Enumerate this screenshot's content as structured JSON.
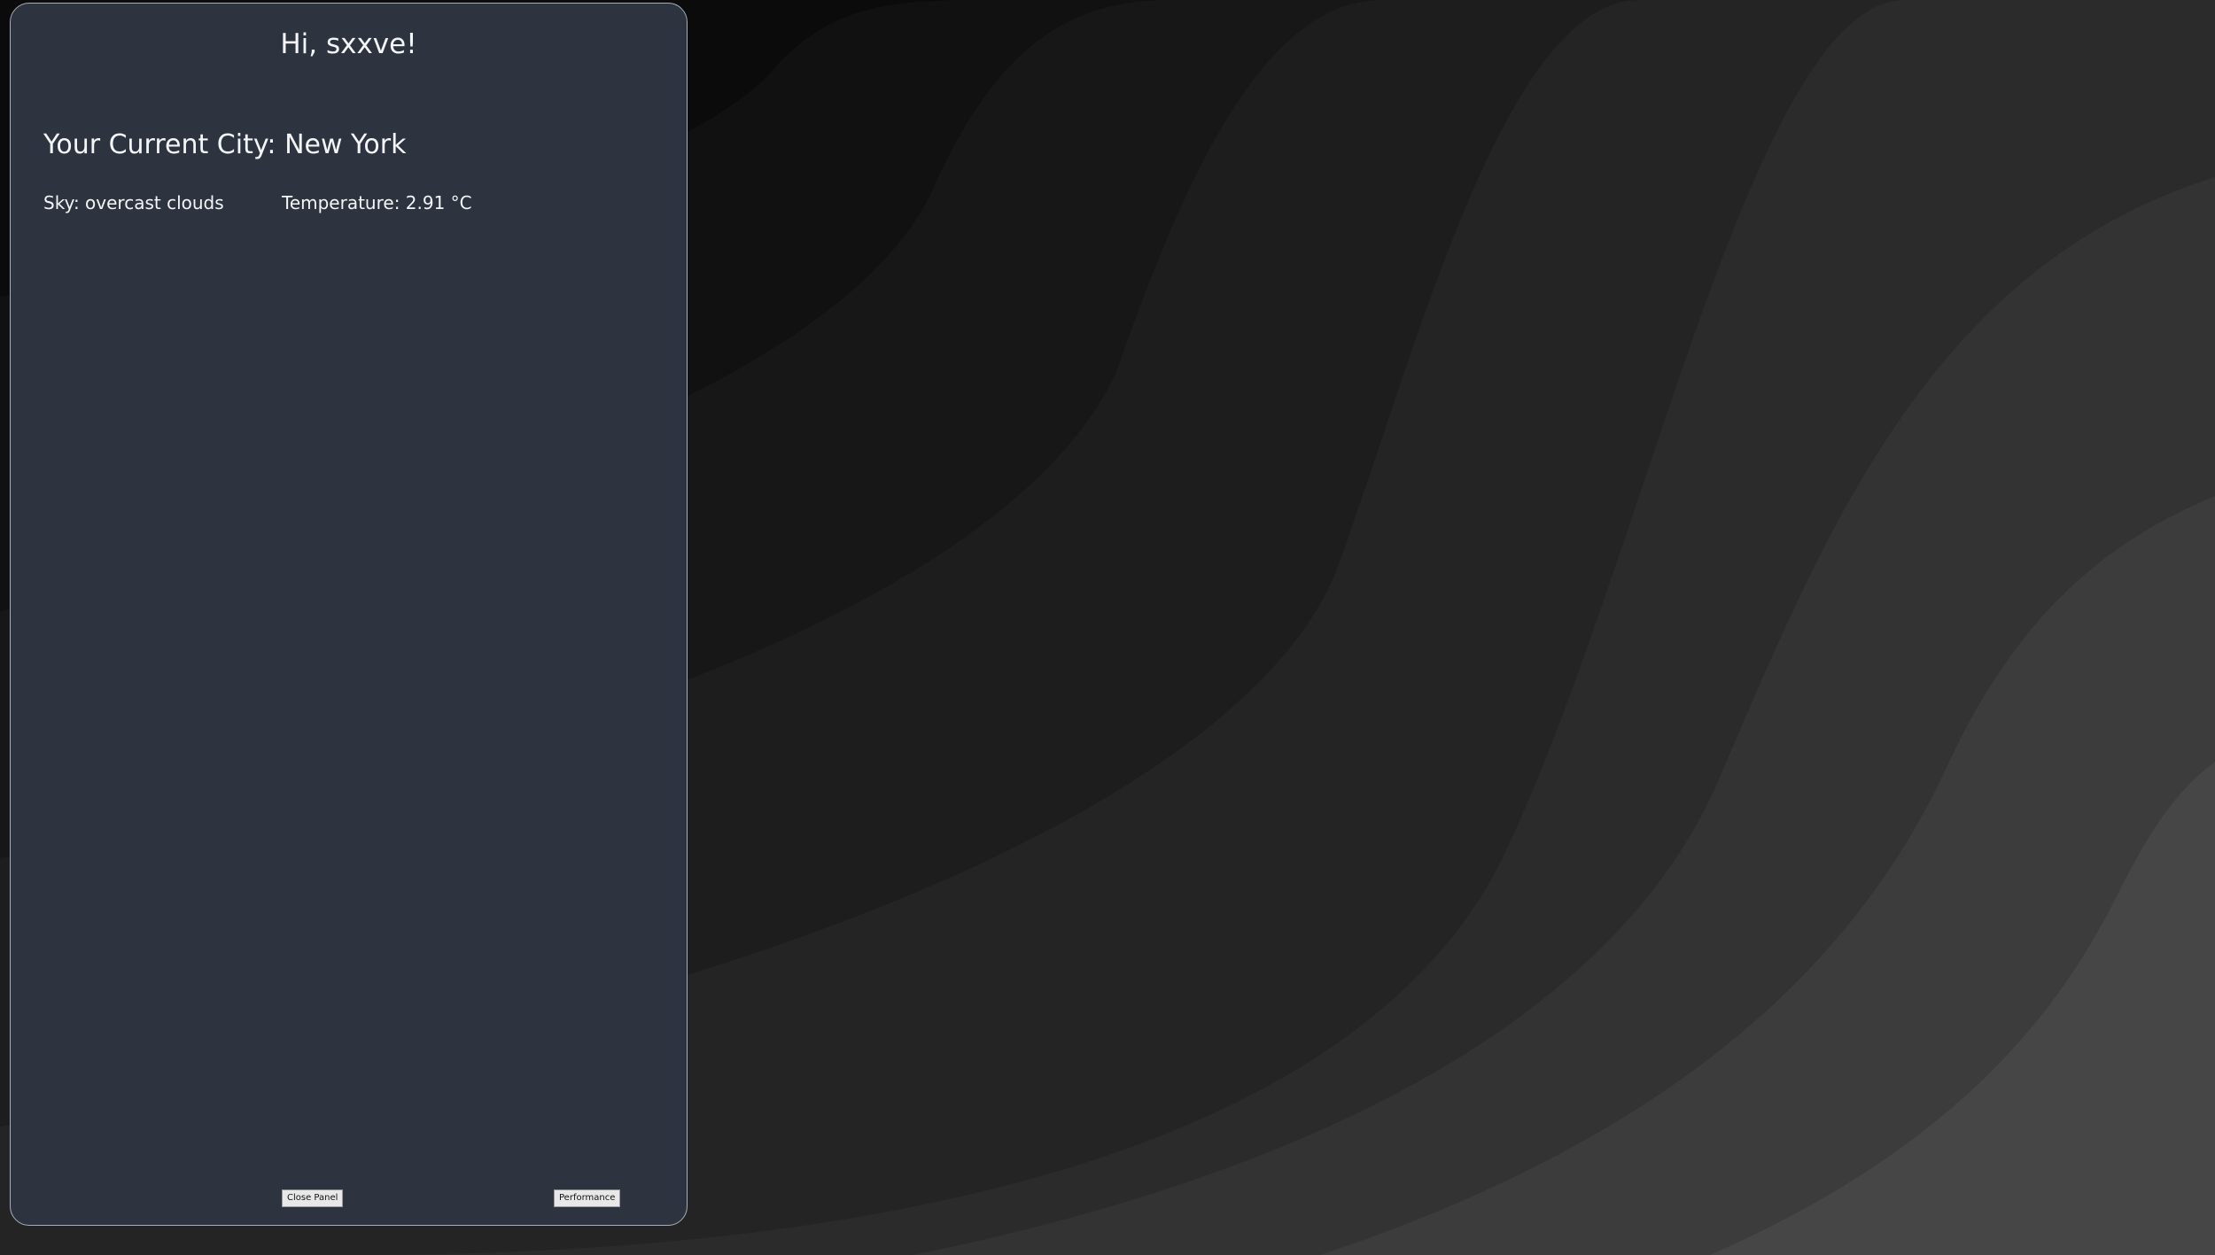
{
  "panel": {
    "greeting": "Hi, sxxve!",
    "city_label": "Your Current City:",
    "city": "New York",
    "sky_label": "Sky:",
    "sky": "overcast clouds",
    "temperature_label": "Temperature:",
    "temperature": "2.91 °C",
    "close_button": "Close Panel",
    "performance_button": "Performance"
  },
  "colors": {
    "panel_background": "#2d3440",
    "panel_text": "#f4f5f7",
    "wallpaper_dark": "#0b0b0b",
    "wallpaper_light": "#4a4a4a"
  }
}
